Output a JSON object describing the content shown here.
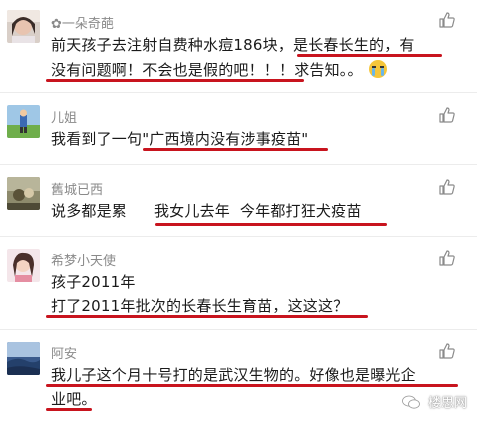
{
  "comments": [
    {
      "name": "✿一朵奇葩",
      "lines": [
        "前天孩子去注射自费种水痘186块，是长春长生的，有",
        "没有问题啊！不会也是假的吧！！！求告知。。"
      ]
    },
    {
      "name": "儿姐",
      "lines": [
        "我看到了一句\"广西境内没有涉事疫苗\""
      ]
    },
    {
      "name": "舊城已西",
      "lines": [
        "说多都是累",
        "我女儿去年  今年都打狂犬疫苗"
      ]
    },
    {
      "name": "希梦小天使",
      "lines": [
        "孩子2011年",
        "打了2011年批次的长春长生育苗，这这这？"
      ]
    },
    {
      "name": "阿安",
      "lines": [
        "我儿子这个月十号打的是武汉生物的。好像也是曝光企",
        "业吧。"
      ]
    }
  ],
  "icons": {
    "like": "thumbs-up-icon",
    "crying_emoji": "crying-face-emoji-icon"
  },
  "colors": {
    "highlight_underline": "#c8141e",
    "name_text": "#8a8a8a",
    "body_text": "#1a1a1a"
  },
  "watermark": {
    "text": "楼思网"
  }
}
